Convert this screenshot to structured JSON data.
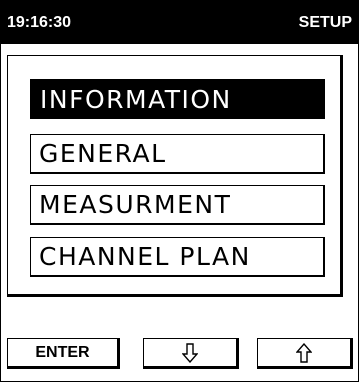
{
  "header": {
    "time": "19:16:30",
    "mode": "SETUP"
  },
  "menu": {
    "items": [
      {
        "label": "INFORMATION",
        "selected": true
      },
      {
        "label": "GENERAL",
        "selected": false
      },
      {
        "label": "MEASURMENT",
        "selected": false
      },
      {
        "label": "CHANNEL PLAN",
        "selected": false
      }
    ]
  },
  "softkeys": {
    "enter_label": "ENTER",
    "down_icon": "arrow-down-icon",
    "up_icon": "arrow-up-icon"
  },
  "colors": {
    "foreground": "#000000",
    "background": "#ffffff"
  }
}
